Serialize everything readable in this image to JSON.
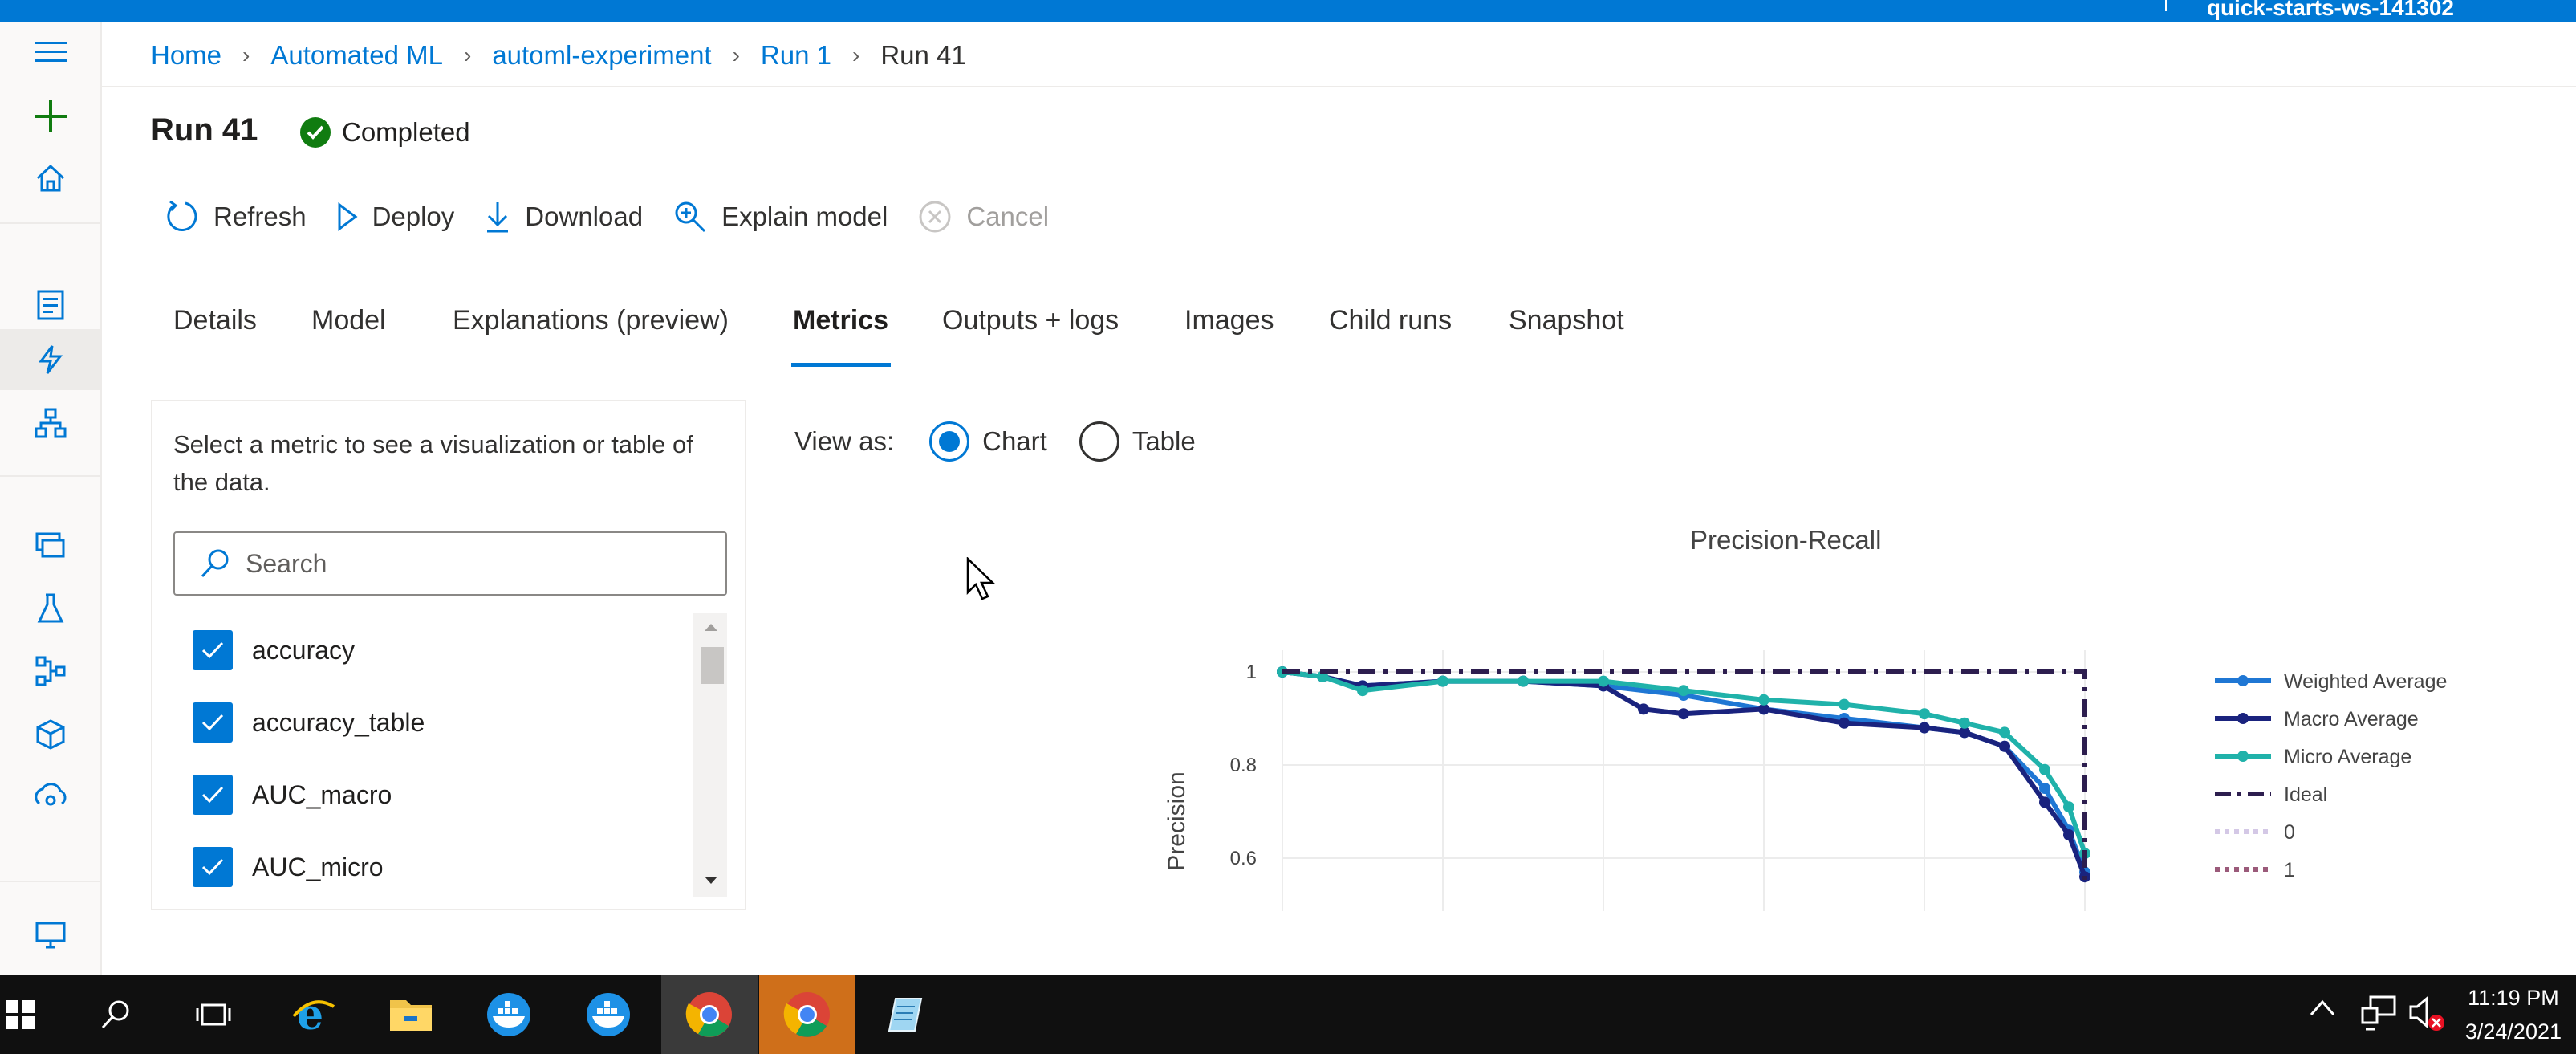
{
  "topbar": {
    "workspace": "quick-starts-ws-141302"
  },
  "breadcrumb": [
    "Home",
    "Automated ML",
    "automl-experiment",
    "Run 1",
    "Run 41"
  ],
  "run": {
    "title": "Run 41",
    "status": "Completed"
  },
  "toolbar": {
    "refresh": "Refresh",
    "deploy": "Deploy",
    "download": "Download",
    "explain": "Explain model",
    "cancel": "Cancel"
  },
  "tabs": [
    "Details",
    "Model",
    "Explanations (preview)",
    "Metrics",
    "Outputs + logs",
    "Images",
    "Child runs",
    "Snapshot"
  ],
  "active_tab": "Metrics",
  "metrics_panel": {
    "description": "Select a metric to see a visualization or table of the data.",
    "search_placeholder": "Search",
    "items": [
      "accuracy",
      "accuracy_table",
      "AUC_macro",
      "AUC_micro"
    ]
  },
  "view_as": {
    "label": "View as:",
    "chart": "Chart",
    "table": "Table",
    "selected": "Chart"
  },
  "chart_data": {
    "type": "line",
    "title": "Precision-Recall",
    "ylabel": "Precision",
    "xlabel": "",
    "ylim": [
      0.55,
      1.0
    ],
    "xlim": [
      0,
      1
    ],
    "y_ticks": [
      "1",
      "0.8",
      "0.6"
    ],
    "legend": "right",
    "series": [
      {
        "name": "Weighted Average",
        "color": "#1f77d4",
        "x": [
          0,
          0.05,
          0.1,
          0.2,
          0.3,
          0.4,
          0.5,
          0.6,
          0.7,
          0.8,
          0.85,
          0.9,
          0.95,
          0.98,
          1.0
        ],
        "y": [
          1.0,
          0.99,
          0.97,
          0.98,
          0.98,
          0.97,
          0.95,
          0.92,
          0.9,
          0.88,
          0.87,
          0.84,
          0.75,
          0.66,
          0.57
        ]
      },
      {
        "name": "Macro Average",
        "color": "#1a237e",
        "x": [
          0,
          0.05,
          0.1,
          0.2,
          0.3,
          0.4,
          0.45,
          0.5,
          0.6,
          0.7,
          0.8,
          0.85,
          0.9,
          0.95,
          0.98,
          1.0
        ],
        "y": [
          1.0,
          0.99,
          0.97,
          0.98,
          0.98,
          0.97,
          0.92,
          0.91,
          0.92,
          0.89,
          0.88,
          0.87,
          0.84,
          0.72,
          0.65,
          0.56
        ]
      },
      {
        "name": "Micro Average",
        "color": "#20b2aa",
        "x": [
          0,
          0.05,
          0.1,
          0.2,
          0.3,
          0.4,
          0.5,
          0.6,
          0.7,
          0.8,
          0.85,
          0.9,
          0.95,
          0.98,
          1.0
        ],
        "y": [
          1.0,
          0.99,
          0.96,
          0.98,
          0.98,
          0.98,
          0.96,
          0.94,
          0.93,
          0.91,
          0.89,
          0.87,
          0.79,
          0.71,
          0.61
        ]
      },
      {
        "name": "Ideal",
        "color": "#2d1e4f",
        "x": [
          0,
          1,
          1
        ],
        "y": [
          1.0,
          1.0,
          0.55
        ]
      }
    ],
    "extra_legend": [
      {
        "name": "0",
        "color": "#d4c8e6"
      },
      {
        "name": "1",
        "color": "#9b5a7a"
      }
    ]
  },
  "taskbar": {
    "time": "11:19 PM",
    "date": "3/24/2021"
  }
}
